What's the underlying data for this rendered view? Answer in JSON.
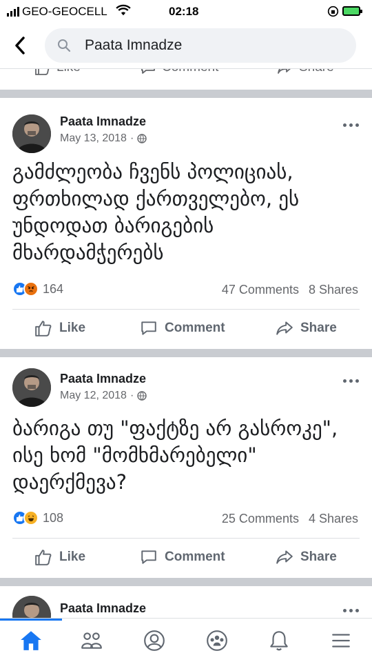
{
  "status_bar": {
    "carrier": "GEO-GEOCELL",
    "time": "02:18",
    "battery_color": "#4cd964"
  },
  "search": {
    "query": "Paata Imnadze",
    "back_icon": "chevron-left-icon",
    "search_icon": "magnifier-icon"
  },
  "partial_actions": {
    "like_label": "Like",
    "comment_label": "Comment",
    "share_label": "Share"
  },
  "posts": [
    {
      "author": "Paata Imnadze",
      "date": "May 13, 2018",
      "privacy_icon": "globe-icon",
      "text": "გამძლეობა ჩვენს პოლიციას, ფრთხილად ქართველებო, ეს უნდოდათ ბარიგების მხარდამჭერებს",
      "reactions": [
        "like",
        "angry"
      ],
      "reaction_count": "164",
      "comments": "47 Comments",
      "shares": "8 Shares",
      "like_label": "Like",
      "comment_label": "Comment",
      "share_label": "Share"
    },
    {
      "author": "Paata Imnadze",
      "date": "May 12, 2018",
      "privacy_icon": "globe-icon",
      "text": "ბარიგა თუ \"ფაქტზე არ გასროკე\", ისე ხომ \"მომხმარებელი\" დაერქმევა?",
      "reactions": [
        "like",
        "haha"
      ],
      "reaction_count": "108",
      "comments": "25 Comments",
      "shares": "4 Shares",
      "like_label": "Like",
      "comment_label": "Comment",
      "share_label": "Share"
    },
    {
      "author": "Paata Imnadze"
    }
  ],
  "bottom_nav": {
    "active_color": "#1877f2",
    "tabs": [
      "home-icon",
      "friends-icon",
      "profile-icon",
      "groups-icon",
      "notifications-icon",
      "menu-icon"
    ]
  }
}
